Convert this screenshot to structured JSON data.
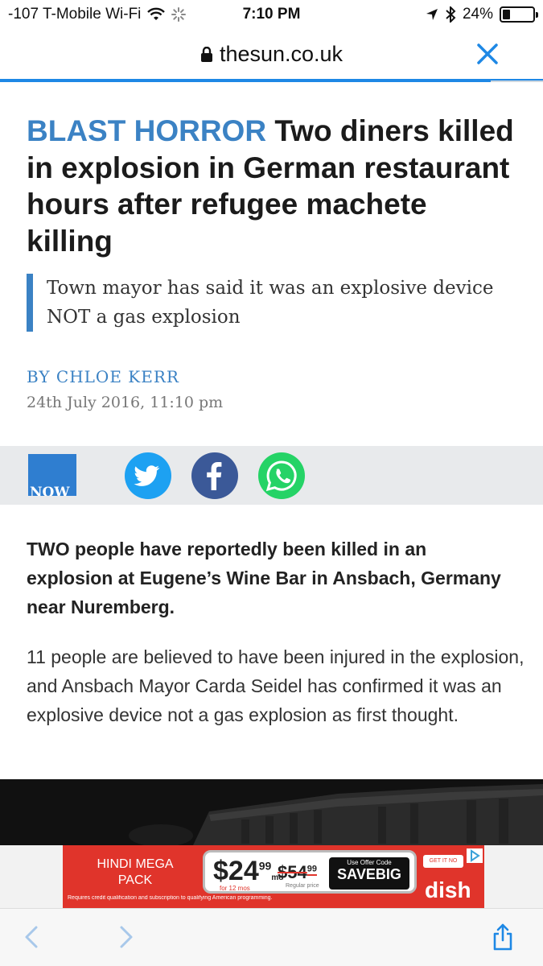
{
  "status_bar": {
    "carrier": "-107 T-Mobile Wi-Fi",
    "time": "7:10 PM",
    "battery": "24%",
    "battery_level": 0.24,
    "icons": [
      "wifi-icon",
      "activity-spinner-icon",
      "location-arrow-icon",
      "bluetooth-icon",
      "battery-icon"
    ]
  },
  "browser": {
    "url": "thesun.co.uk",
    "lock_icon": "lock-icon",
    "close_icon": "close-icon",
    "accent": "#1e88e5"
  },
  "article": {
    "kicker": "BLAST HORROR",
    "headline": "Two diners killed in explosion in German restaurant hours after refugee machete killing",
    "standfirst": "Town mayor has said it was an explosive device NOT a gas explosion",
    "byline": "BY CHLOE KERR",
    "date": "24th July 2016, 11:10 pm",
    "lead": "TWO people have reportedly been killed in an explosion at Eugene’s Wine Bar in Ansbach, Germany near Nuremberg.",
    "paragraph": "11 people are believed to have been injured in the explosion, and Ansbach Mayor Carda Seidel has confirmed it was an explosive device not a gas explosion as first thought.",
    "accent": "#3b82c4"
  },
  "share": {
    "now_label": "NOW",
    "icons": [
      "twitter-icon",
      "facebook-icon",
      "whatsapp-icon"
    ]
  },
  "ad": {
    "title": "HINDI MEGA PACK",
    "price_main": "$24",
    "price_main_cents": "99",
    "price_main_unit": "mo",
    "price_main_note": "for 12 mos",
    "price_regular": "$54",
    "price_regular_cents": "99",
    "price_regular_note": "Regular price",
    "offer_label": "Use Offer Code",
    "offer_code": "SAVEBIG",
    "cta": "GET IT NO",
    "fine_print": "Requires credit qualification and subscription to qualifying American programming.",
    "brand": "dish"
  },
  "toolbar": {
    "icons": [
      "back-arrow-icon",
      "forward-arrow-icon",
      "share-icon"
    ]
  }
}
